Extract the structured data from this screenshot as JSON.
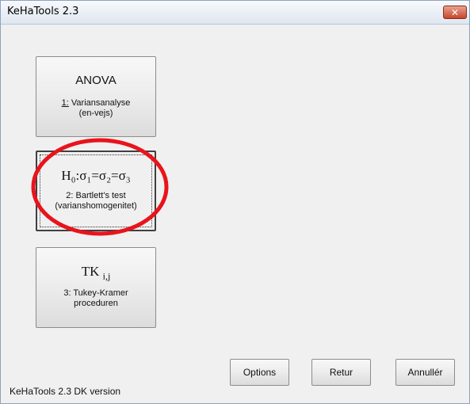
{
  "window": {
    "title": "KeHaTools 2.3",
    "close_glyph": "✕"
  },
  "buttons": {
    "anova": {
      "main": "ANOVA",
      "sub_line1": "1: Variansanalyse",
      "sub_line2": "(en-vejs)"
    },
    "bartlett": {
      "main": "H₀:σ₁=σ₂=σ₃",
      "sub_line1": "2: Bartlett's test",
      "sub_line2": "(varianshomogenitet)"
    },
    "tukey": {
      "main_base": "TK",
      "main_sub": "i,j",
      "sub_line1": "3: Tukey-Kramer",
      "sub_line2": "proceduren"
    }
  },
  "footer": {
    "options_label": "Options",
    "retur_label": "Retur",
    "annuller_label": "Annullér",
    "version_text": "KeHaTools 2.3  DK version"
  },
  "annotation": {
    "color": "#e8141c"
  }
}
